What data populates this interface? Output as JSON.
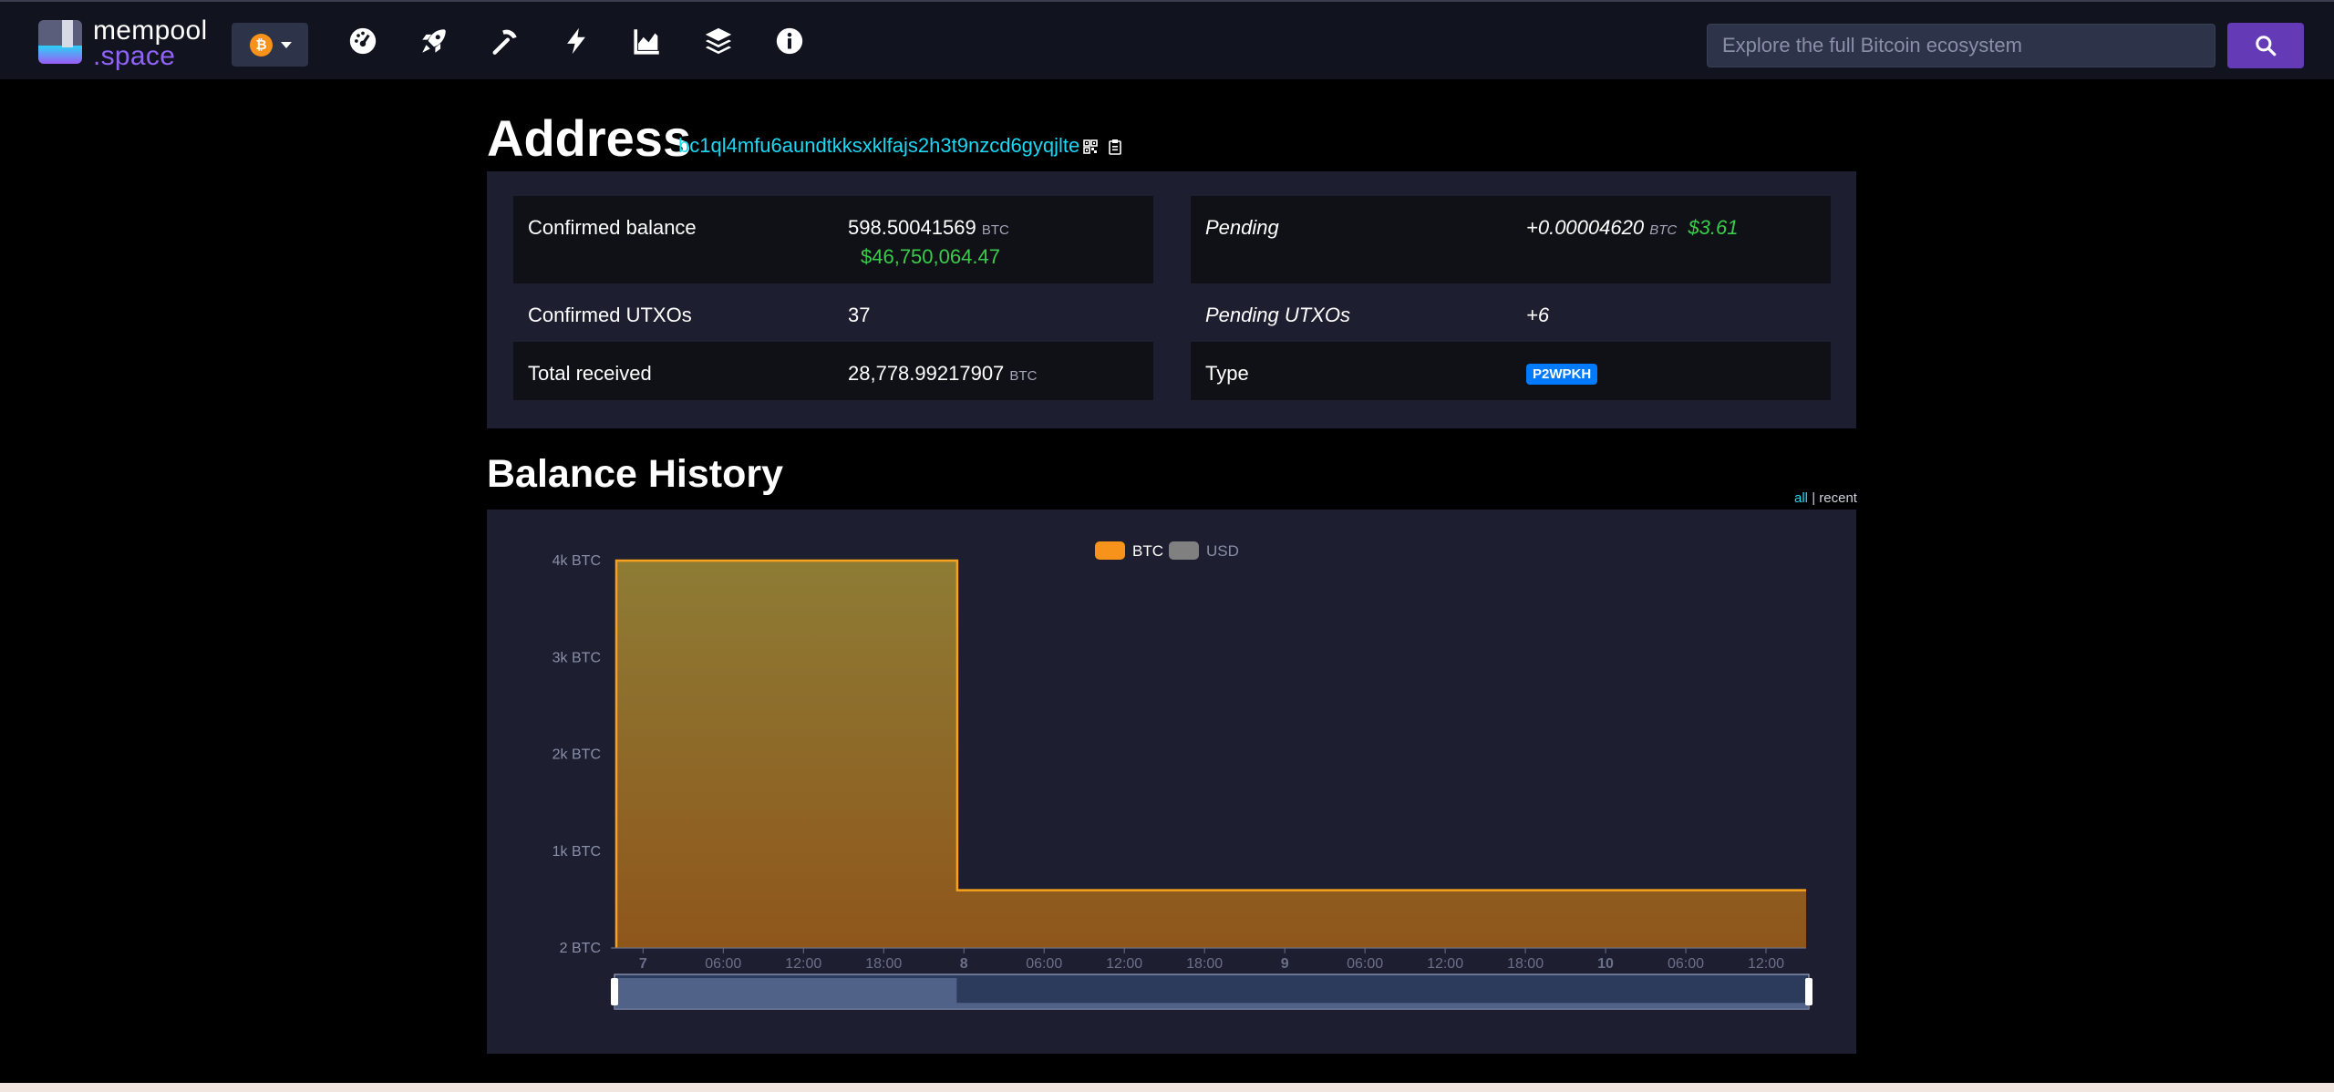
{
  "nav": {
    "logo_top": "mempool",
    "logo_bottom": ".space",
    "network_symbol": "₿",
    "icons": [
      "dashboard-icon",
      "rocket-icon",
      "mining-icon",
      "lightning-icon",
      "graphs-icon",
      "layers-icon",
      "info-icon"
    ],
    "search_placeholder": "Explore the full Bitcoin ecosystem"
  },
  "address": {
    "heading": "Address",
    "value": "bc1ql4mfu6aundtkksxklfajs2h3t9nzcd6gyqjlte"
  },
  "info": {
    "left": [
      {
        "label": "Confirmed balance",
        "value": "598.50041569",
        "unit": "BTC",
        "fiat": "$46,750,064.47"
      },
      {
        "label": "Confirmed UTXOs",
        "value": "37"
      },
      {
        "label": "Total received",
        "value": "28,778.99217907",
        "unit": "BTC"
      }
    ],
    "right": [
      {
        "label": "Pending",
        "value": "+0.00004620",
        "unit": "BTC",
        "fiat": "$3.61"
      },
      {
        "label": "Pending UTXOs",
        "value": "+6"
      },
      {
        "label": "Type",
        "value": "P2WPKH"
      }
    ]
  },
  "balance_history": {
    "title": "Balance History",
    "toggle_all": "all",
    "toggle_sep": "|",
    "toggle_recent": "recent"
  },
  "chart_data": {
    "type": "area",
    "series": [
      {
        "name": "BTC",
        "color": "#f7931a"
      }
    ],
    "legend": [
      {
        "name": "BTC",
        "color": "#f7931a",
        "active": true
      },
      {
        "name": "USD",
        "color": "#808080",
        "active": false
      }
    ],
    "legend_position": "top-center",
    "y_ticks": [
      "2 BTC",
      "1k BTC",
      "2k BTC",
      "3k BTC",
      "4k BTC"
    ],
    "ylim": [
      2,
      4000
    ],
    "x_ticks": [
      "7",
      "06:00",
      "12:00",
      "18:00",
      "8",
      "06:00",
      "12:00",
      "18:00",
      "9",
      "06:00",
      "12:00",
      "18:00",
      "10",
      "06:00",
      "12:00"
    ],
    "x_range_hours": [
      -2,
      87
    ],
    "points": [
      {
        "t": -2,
        "y": 4000
      },
      {
        "t": 23.5,
        "y": 4000
      },
      {
        "t": 23.5,
        "y": 598.5
      },
      {
        "t": 87,
        "y": 598.5
      }
    ]
  }
}
